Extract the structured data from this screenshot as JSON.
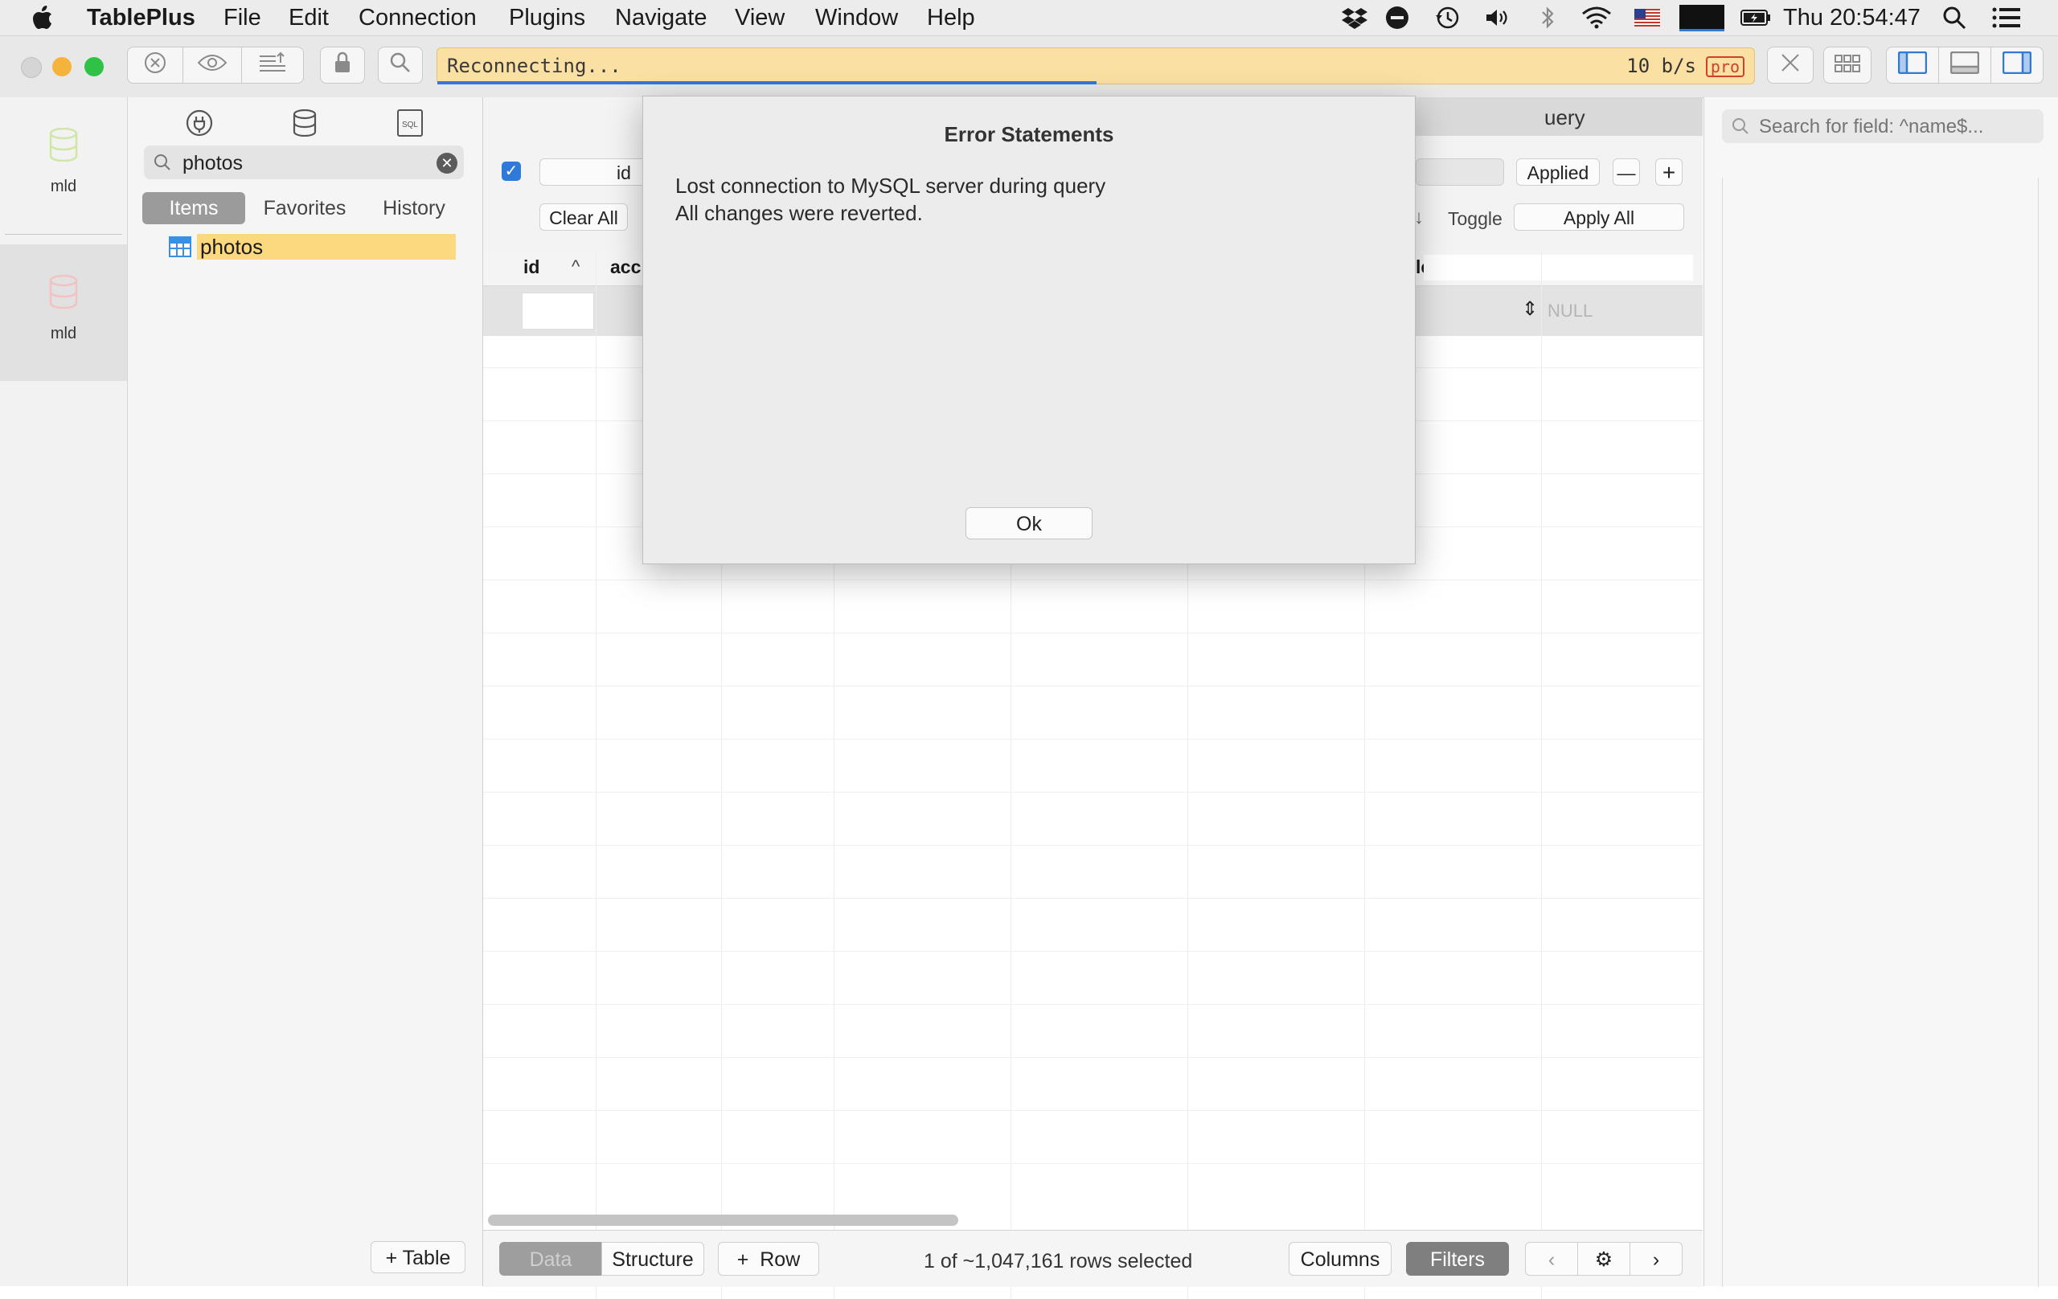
{
  "menubar": {
    "app_name": "TablePlus",
    "items": [
      "File",
      "Edit",
      "Connection",
      "Plugins",
      "Navigate",
      "View",
      "Window",
      "Help"
    ],
    "clock": "Thu 20:54:47"
  },
  "toolbar": {
    "status_text": "Reconnecting...",
    "rate": "10 b/s",
    "pro_badge": "pro"
  },
  "connections": [
    {
      "label": "mld",
      "color": "#cfe6a8"
    },
    {
      "label": "mld",
      "color": "#f2c2c2"
    }
  ],
  "sidebar": {
    "search_value": "photos",
    "segments": [
      "Items",
      "Favorites",
      "History"
    ],
    "selected_segment": "Items",
    "tree_items": [
      "photos"
    ],
    "add_table_label": "Table"
  },
  "main": {
    "query_tab_label": "uery",
    "filter": {
      "field": "id",
      "applied_label": "Applied",
      "clear_all_label": "Clear All",
      "toggle_label": "Toggle",
      "apply_all_label": "Apply All",
      "sort_arrow": "↓"
    },
    "columns": [
      "id",
      "acc",
      "le"
    ],
    "null_placeholder": "NULL",
    "bottom": {
      "data_label": "Data",
      "structure_label": "Structure",
      "row_label": "Row",
      "row_count": "1 of ~1,047,161 rows selected",
      "columns_label": "Columns",
      "filters_label": "Filters"
    }
  },
  "right_panel": {
    "search_placeholder": "Search for field: ^name$..."
  },
  "dialog": {
    "title": "Error Statements",
    "line1": "Lost connection to MySQL server during query",
    "line2": "All changes were reverted.",
    "ok_label": "Ok"
  }
}
